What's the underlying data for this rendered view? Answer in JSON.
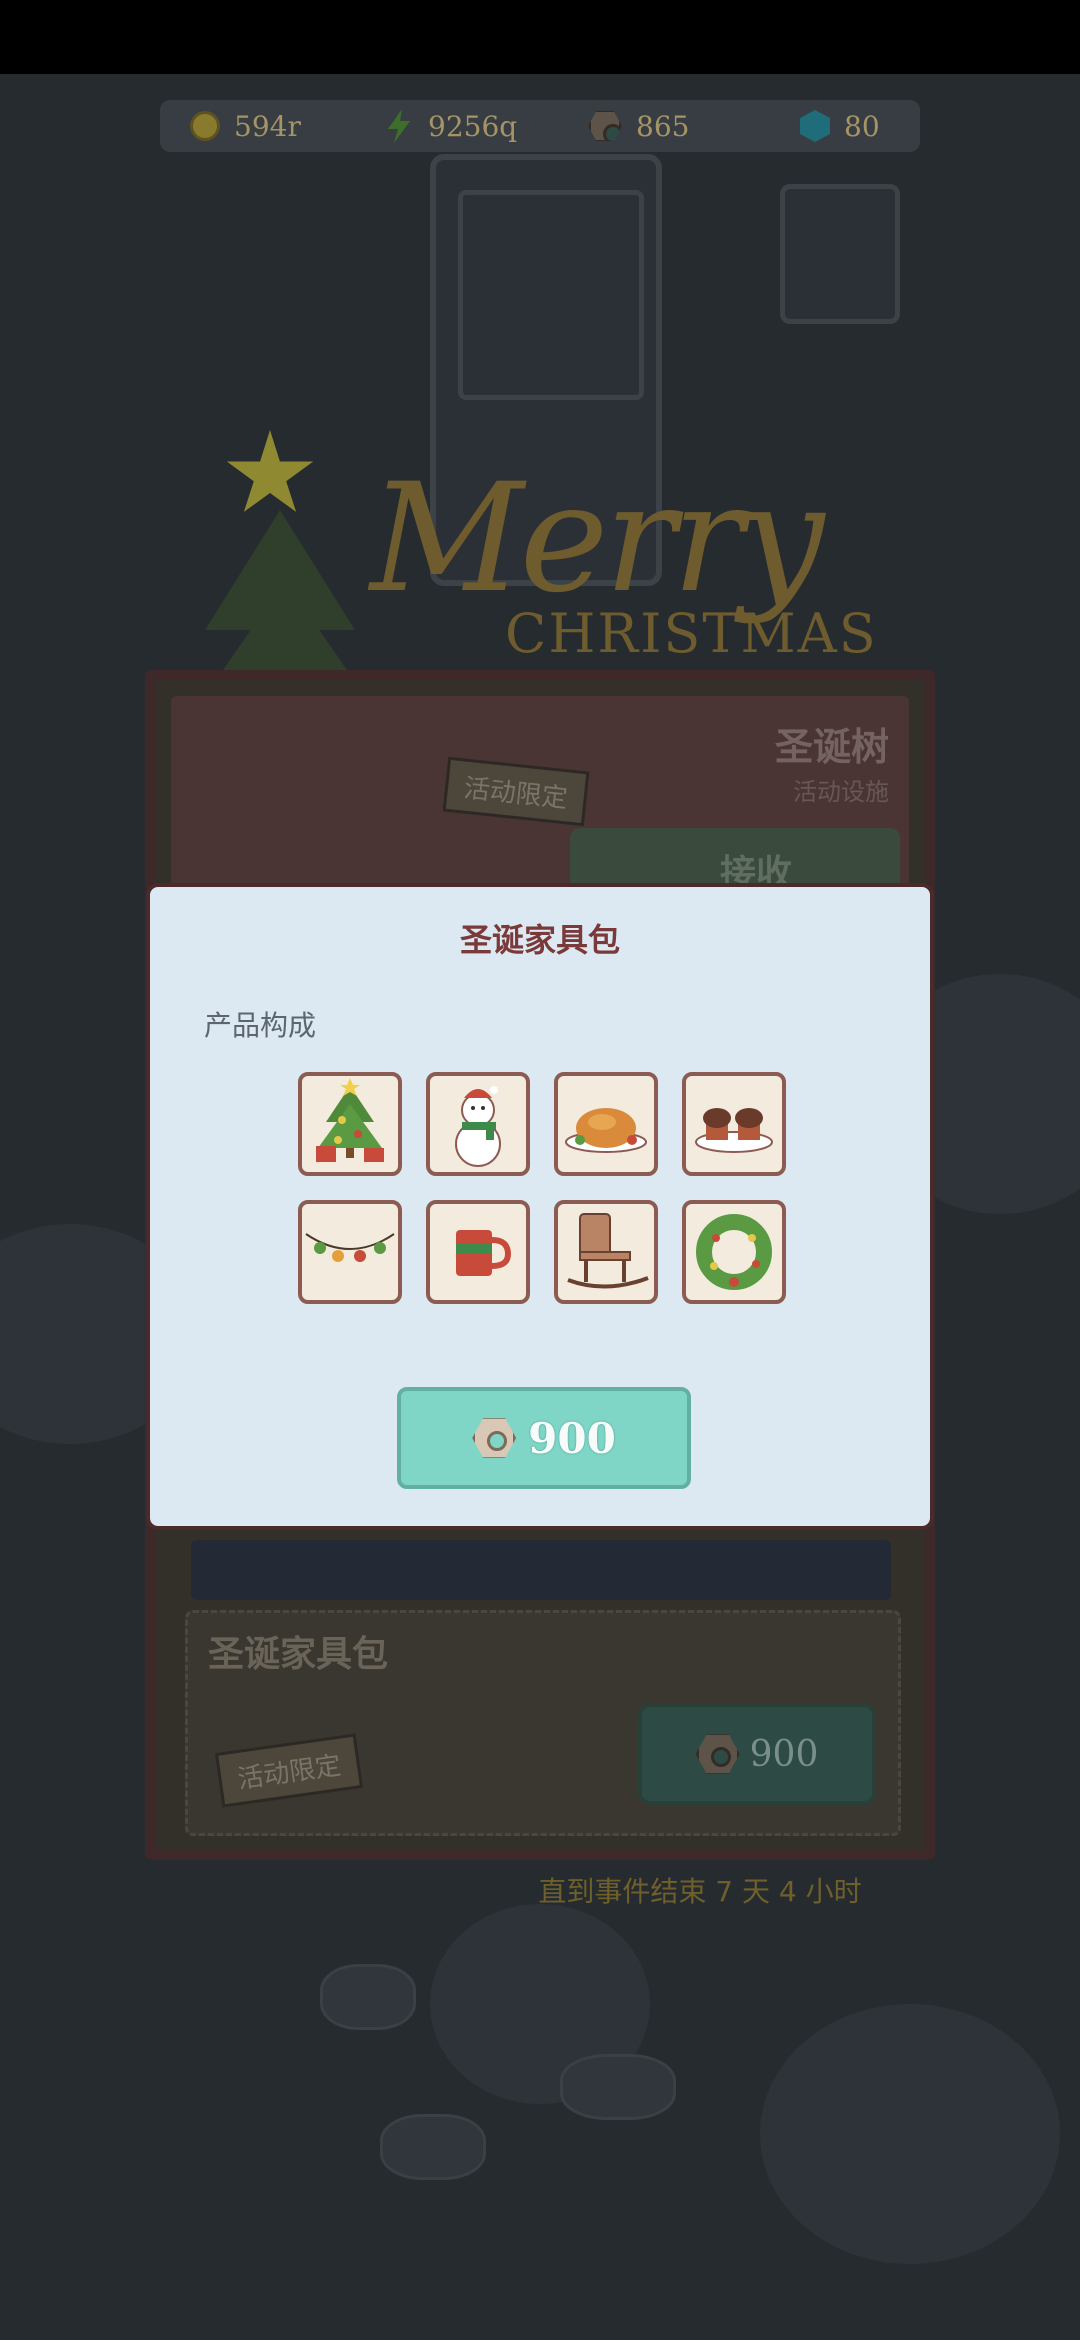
{
  "hud": {
    "coins": "594r",
    "energy": "9256q",
    "nuts": "865",
    "gems": "80"
  },
  "banner": {
    "script": "Merry",
    "line2": "CHRISTMAS"
  },
  "event": {
    "title": "圣诞树",
    "subtitle": "活动设施",
    "limited_tag": "活动限定",
    "claim_label": "接收",
    "bundle_name": "圣诞家具包",
    "bundle_tag": "活动限定",
    "bundle_price": "900",
    "countdown": "直到事件结束  7 天 4 小时"
  },
  "modal": {
    "title": "圣诞家具包",
    "section": "产品构成",
    "items": [
      {
        "name": "christmas-tree-icon"
      },
      {
        "name": "snowman-icon"
      },
      {
        "name": "roast-turkey-icon"
      },
      {
        "name": "muffins-icon"
      },
      {
        "name": "string-lights-icon"
      },
      {
        "name": "mug-icon"
      },
      {
        "name": "rocking-chair-icon"
      },
      {
        "name": "wreath-icon"
      }
    ],
    "price": "900"
  },
  "colors": {
    "modal_bg": "#dce9f3",
    "modal_border": "#4a2a2a",
    "price_button": "#7fd6c7",
    "title": "#7a3a3a"
  }
}
